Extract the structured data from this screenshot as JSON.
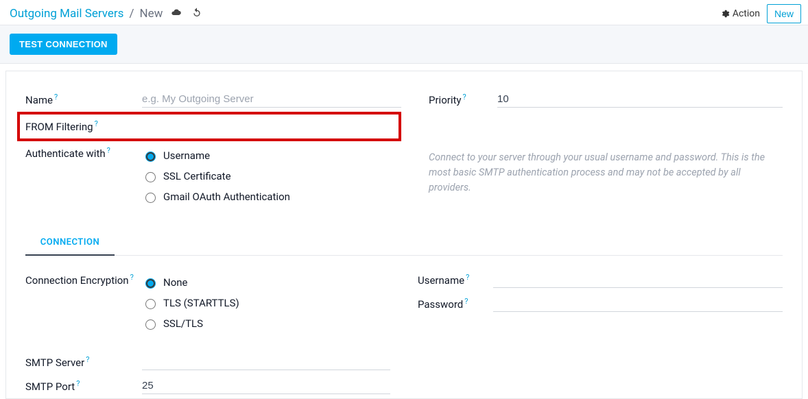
{
  "breadcrumb": {
    "root": "Outgoing Mail Servers",
    "sep": "/",
    "current": "New"
  },
  "topbar": {
    "action": "Action",
    "new": "New"
  },
  "buttons": {
    "test_connection": "TEST CONNECTION"
  },
  "labels": {
    "name": "Name",
    "from_filtering": "FROM Filtering",
    "authenticate_with": "Authenticate with",
    "priority": "Priority",
    "connection_encryption": "Connection Encryption",
    "smtp_server": "SMTP Server",
    "smtp_port": "SMTP Port",
    "username": "Username",
    "password": "Password"
  },
  "placeholders": {
    "name": "e.g. My Outgoing Server"
  },
  "values": {
    "priority": "10",
    "smtp_port": "25"
  },
  "auth_options": {
    "username": "Username",
    "ssl_cert": "SSL Certificate",
    "gmail_oauth": "Gmail OAuth Authentication"
  },
  "encryption_options": {
    "none": "None",
    "tls": "TLS (STARTTLS)",
    "ssl": "SSL/TLS"
  },
  "help": {
    "auth": "Connect to your server through your usual username and password. This is the most basic SMTP authentication process and may not be accepted by all providers."
  },
  "tabs": {
    "connection": "CONNECTION"
  },
  "q": "?"
}
